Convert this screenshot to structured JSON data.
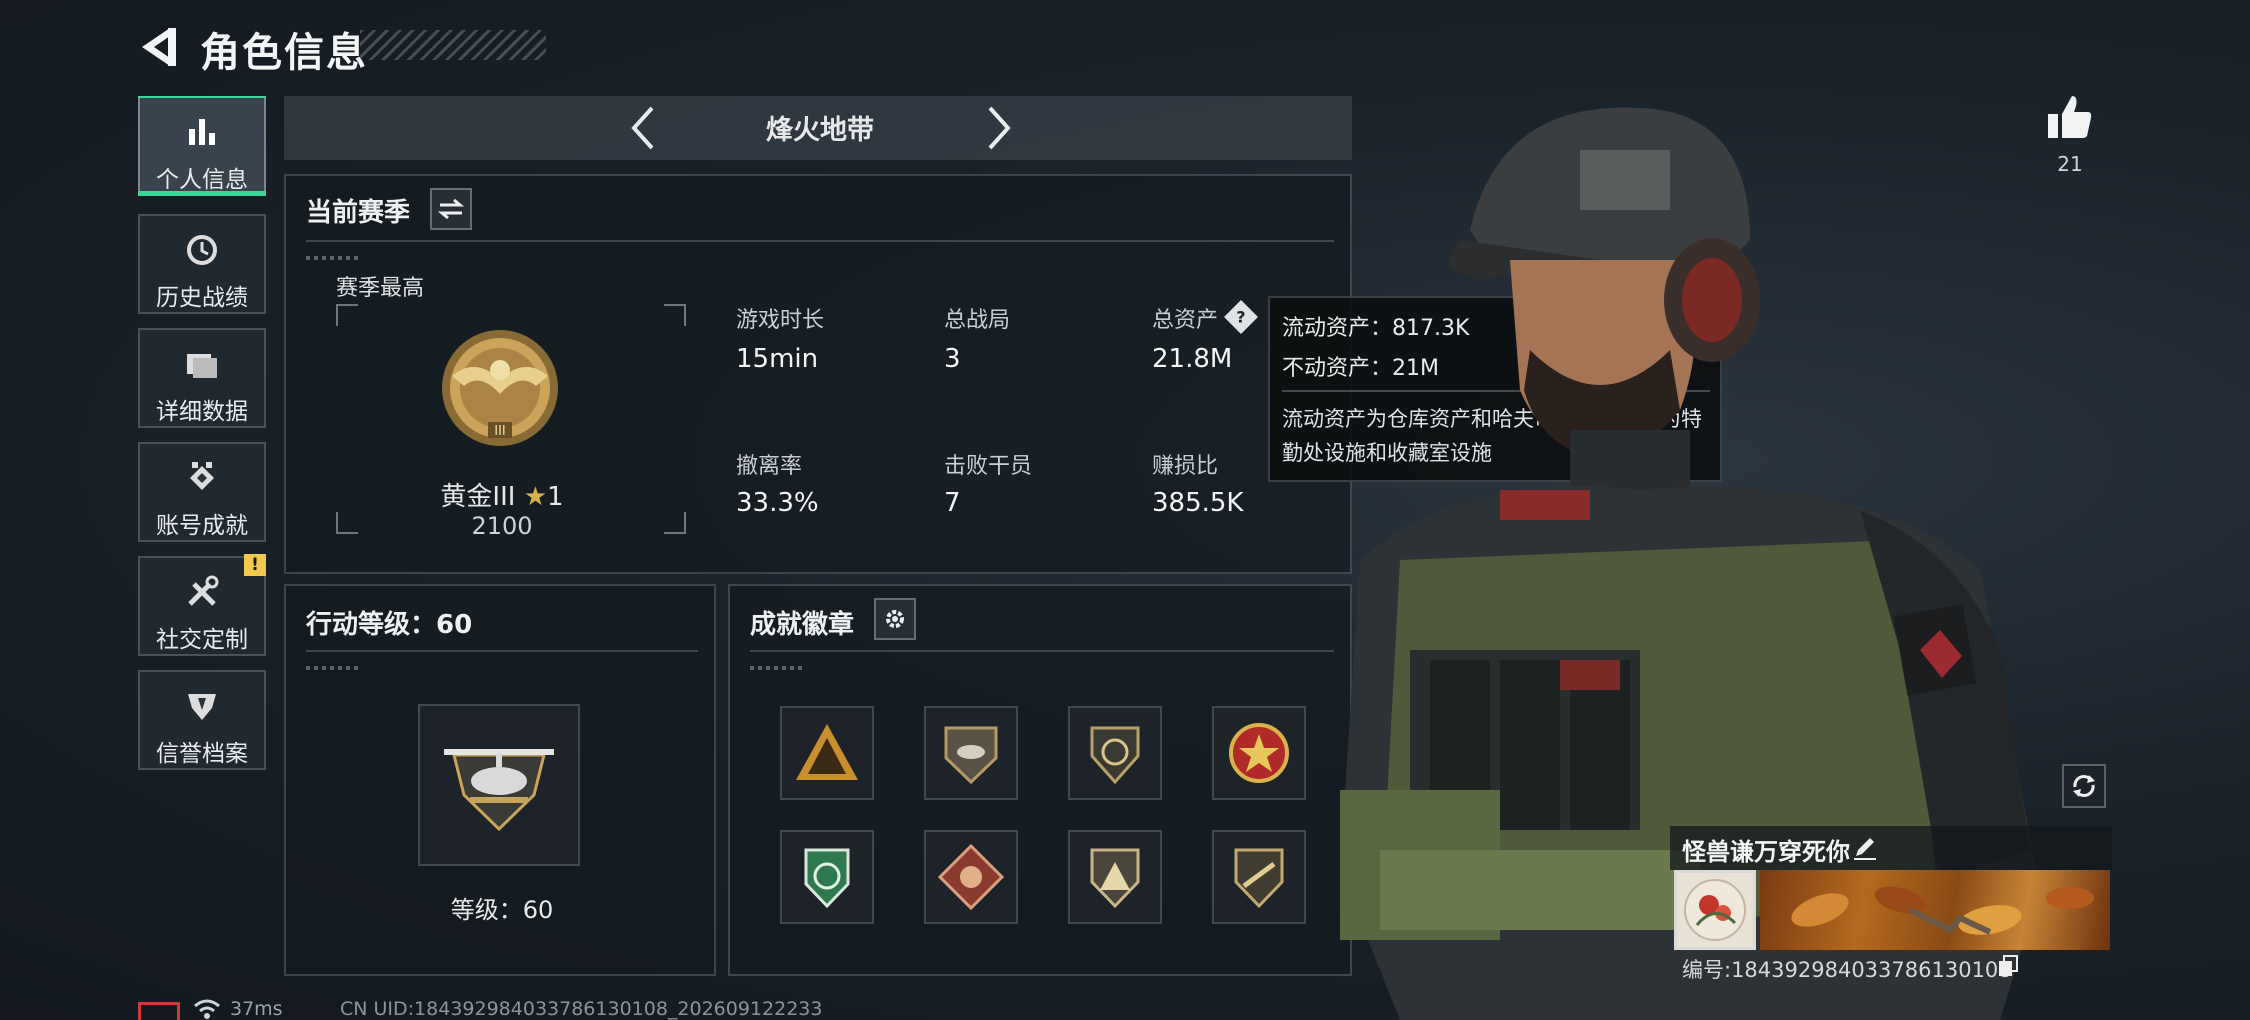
{
  "header": {
    "title": "角色信息"
  },
  "sidebar": {
    "items": [
      {
        "label": "个人信息",
        "icon": "bar-chart-icon",
        "active": true
      },
      {
        "label": "历史战绩",
        "icon": "history-icon"
      },
      {
        "label": "详细数据",
        "icon": "folder-icon"
      },
      {
        "label": "账号成就",
        "icon": "achievement-icon"
      },
      {
        "label": "社交定制",
        "icon": "tools-icon",
        "badge": "!"
      },
      {
        "label": "信誉档案",
        "icon": "shield-icon"
      }
    ]
  },
  "mode": {
    "title": "烽火地带"
  },
  "season": {
    "title": "当前赛季",
    "best_label": "赛季最高",
    "rank_name": "黄金III",
    "rank_stars": "1",
    "rank_score": "2100",
    "stats": [
      {
        "label": "游戏时长",
        "value": "15min"
      },
      {
        "label": "总战局",
        "value": "3"
      },
      {
        "label": "总资产",
        "value": "21.8M"
      },
      {
        "label": "撤离率",
        "value": "33.3%"
      },
      {
        "label": "击败干员",
        "value": "7"
      },
      {
        "label": "赚损比",
        "value": "385.5K"
      }
    ]
  },
  "tooltip": {
    "line1": "流动资产：817.3K",
    "line2": "不动资产：21M",
    "note": "流动资产为仓库资产和哈夫币，不动资产为特勤处设施和收藏室设施"
  },
  "level": {
    "title": "行动等级：60",
    "label": "等级：60"
  },
  "achievements": {
    "title": "成就徽章"
  },
  "profile": {
    "likes": "21",
    "name": "怪兽谦万穿死你",
    "id": "编号:1843929840337861301​08"
  },
  "footer": {
    "ping": "37ms",
    "uid": "CN UID:1843929840337861301​08_202609122233"
  },
  "colors": {
    "accent": "#3fd49a",
    "warning": "#f2c94c",
    "gold": "#c9a45a"
  }
}
